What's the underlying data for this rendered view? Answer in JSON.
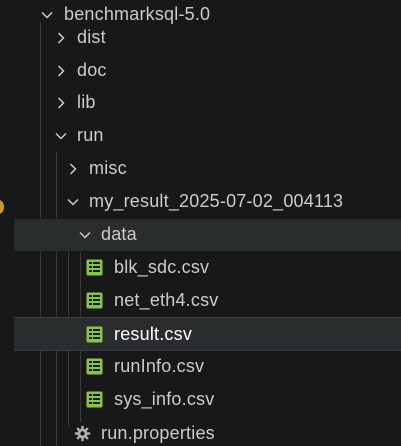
{
  "explorer": {
    "root": {
      "label": "benchmarksql-5.0"
    },
    "dist": {
      "label": "dist"
    },
    "doc": {
      "label": "doc"
    },
    "lib": {
      "label": "lib"
    },
    "run": {
      "label": "run"
    },
    "misc": {
      "label": "misc"
    },
    "result_dir": {
      "label": "my_result_2025-07-02_004113"
    },
    "data": {
      "label": "data"
    },
    "files": [
      {
        "label": "blk_sdc.csv",
        "icon": "csv-file-icon"
      },
      {
        "label": "net_eth4.csv",
        "icon": "csv-file-icon"
      },
      {
        "label": "result.csv",
        "icon": "csv-file-icon",
        "selected": true
      },
      {
        "label": "runInfo.csv",
        "icon": "csv-file-icon"
      },
      {
        "label": "sys_info.csv",
        "icon": "csv-file-icon"
      }
    ],
    "properties": {
      "label": "run.properties",
      "icon": "gear-icon"
    }
  },
  "colors": {
    "background": "#181818",
    "text": "#cccccc",
    "selected_text": "#ffffff",
    "row_highlight": "#2a2d2e",
    "csv_icon": "#8bc34a",
    "indent_guide": "#3a3a3a",
    "modified_dot": "#c7962f"
  }
}
